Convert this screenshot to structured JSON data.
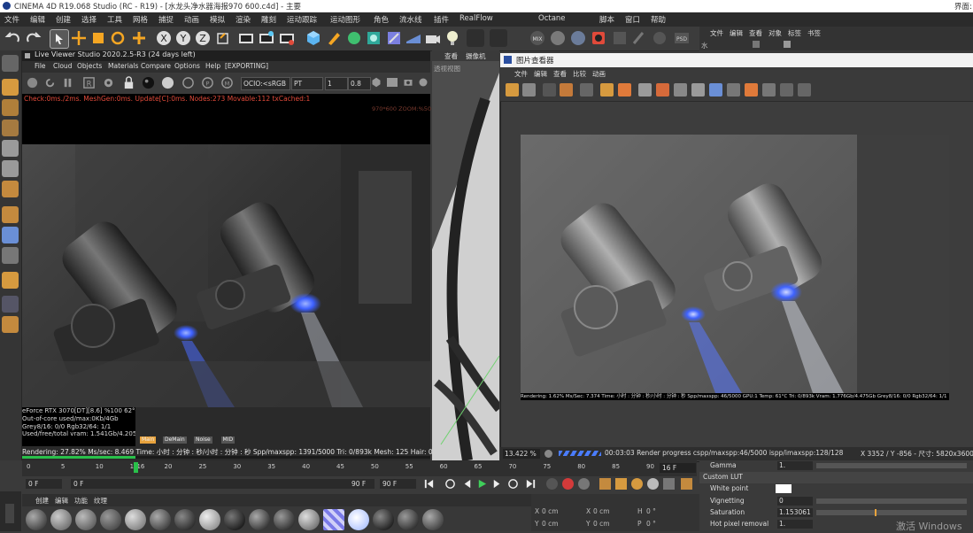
{
  "titlebar": {
    "title": "CINEMA 4D R19.068 Studio (RC - R19) - [水龙头净水器海报970 600.c4d] - 主要",
    "right_label": "界面:"
  },
  "menubar": {
    "items": [
      "文件",
      "编辑",
      "创建",
      "选择",
      "工具",
      "网格",
      "捕捉",
      "动画",
      "模拟",
      "渲染",
      "雕刻",
      "运动跟踪",
      "运动图形",
      "角色",
      "流水线",
      "插件",
      "RealFlow",
      "Octane",
      "脚本",
      "窗口",
      "帮助"
    ]
  },
  "right_panel": {
    "menu": [
      "文件",
      "编辑",
      "查看",
      "对象",
      "标签",
      "书签"
    ],
    "obj_label": "水"
  },
  "live_viewer": {
    "title": "Live Viewer Studio 2020.2.5-R3 (24 days left)",
    "menu": [
      "File",
      "Cloud",
      "Objects",
      "Materials",
      "Compare",
      "Options",
      "Help",
      "[EXPORTING]"
    ],
    "ocio": "OCIO:<sRGB",
    "mode": "PT",
    "num1": "1",
    "num2": "0.8",
    "status_line": "Check:0ms./2ms. MeshGen:0ms. Update[C]:0ms. Nodes:273 Movable:112 txCached:1",
    "zoom_info": "970*600 ZOOM:%50",
    "info": [
      "eForce RTX 3070[DT][8.6]  %100    62°C",
      "Out-of-core used/max:0Kb/4Gb",
      "Grey8/16: 0/0        Rgb32/64: 1/1",
      "Used/free/total vram: 1.541Gb/4.205Gb/8G"
    ],
    "tags": [
      "Main",
      "DeMain",
      "Noise",
      "MID"
    ],
    "progress": "Rendering: 27.82%  Ms/sec: 8.469   Time: 小时 : 分钟 : 秒/小时 : 分钟 : 秒  Spp/maxspp: 1391/5000  Tri: 0/893k   Mesh: 125  Hair: 0   RTX:off",
    "progress_value": 0.278
  },
  "viewport": {
    "tabs": [
      "查看",
      "摄像机"
    ],
    "sub": "透视视图"
  },
  "picture_viewer": {
    "title": "图片查看器",
    "menu": [
      "文件",
      "编辑",
      "查看",
      "比较",
      "动画"
    ],
    "render_strip": "Rendering: 1.62% Ms/Sec: 7.374  Time: 小时 : 分钟 : 秒/小时 : 分钟 : 秒  Spp/maxspp: 46/5000  GPU:1  Temp: 61°C  Tri: 0/893k  Vram: 1.776Gb/4.475Gb  Grey8/16: 0/0  Rgb32/64: 1/1",
    "zoom": "13.422 %",
    "render_info": "00:03:03 Render progress  cspp/maxspp:46/5000  ispp/imaxspp:128/128",
    "coords": "X 3352 / Y -856 - 尺寸: 5820x3600, RGB ("
  },
  "timeline": {
    "ticks": [
      "0",
      "5",
      "10",
      "15",
      "16",
      "20",
      "25",
      "30",
      "35",
      "40",
      "45",
      "50",
      "55",
      "60",
      "65",
      "70",
      "75",
      "80",
      "85",
      "90"
    ],
    "current_frame": "16 F",
    "playhead": 16,
    "end": 90
  },
  "transport": {
    "start": "0 F",
    "field": "0 F",
    "end_field": "90 F",
    "end": "90 F"
  },
  "materials": {
    "menu": [
      "创建",
      "编辑",
      "功能",
      "纹理"
    ]
  },
  "coords_panel": {
    "rows": [
      [
        "X",
        "0 cm",
        "X",
        "0 cm",
        "H",
        "0 °"
      ],
      [
        "Y",
        "0 cm",
        "Y",
        "0 cm",
        "P",
        "0 °"
      ]
    ]
  },
  "attributes": {
    "gamma_label": "Gamma",
    "gamma_value": "1.",
    "custom_lut": "Custom LUT",
    "white_point": "White point",
    "vignetting_label": "Vignetting",
    "vignetting_value": "0",
    "saturation_label": "Saturation",
    "saturation_value": "1.153061",
    "hot_pixel_label": "Hot pixel removal",
    "hot_pixel_value": "1."
  },
  "watermark": "激活 Windows",
  "colors": {
    "accent_orange": "#e8a33d",
    "live_status_red": "#e04a3a",
    "progress_green": "#29c04a",
    "glow_blue": "#4a7cff"
  }
}
